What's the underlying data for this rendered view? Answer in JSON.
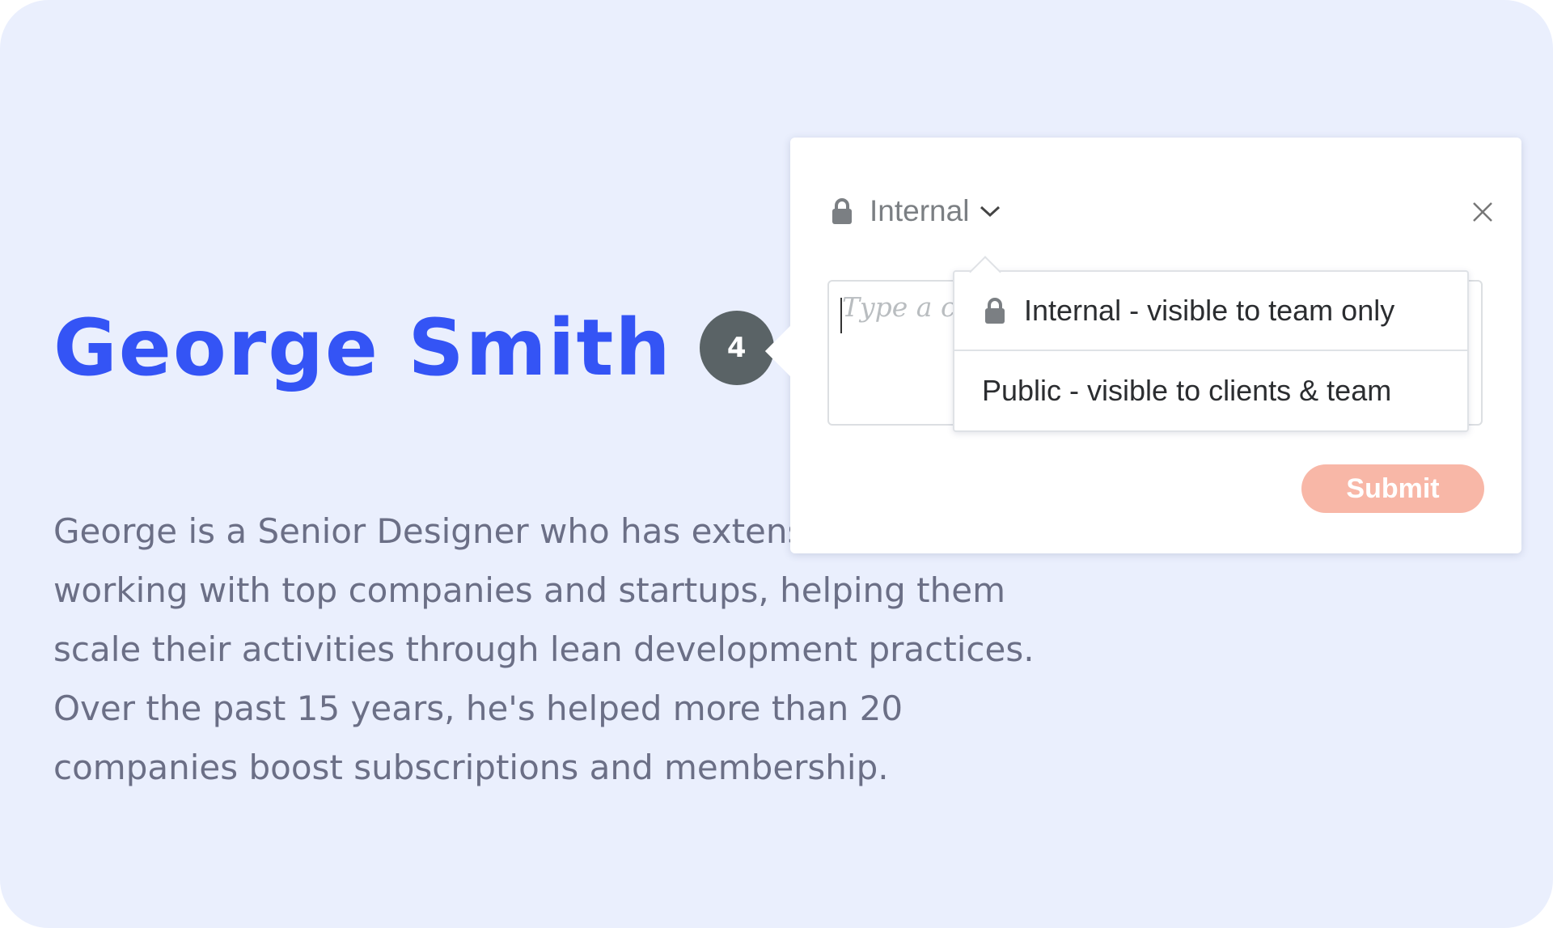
{
  "profile": {
    "name": "George Smith",
    "badge_count": "4",
    "bio": "George is a Senior Designer who has extensive experience working with top companies and startups, helping them scale their activities through lean development practices. Over the past 15 years, he's helped more than 20 companies boost subscriptions and membership."
  },
  "comment_popover": {
    "visibility_label": "Internal",
    "input_placeholder": "Type a comment...",
    "submit_label": "Submit",
    "visibility_options": [
      {
        "label": "Internal - visible to team only",
        "icon": "lock-icon"
      },
      {
        "label": "Public - visible to clients & team"
      }
    ],
    "icons": {
      "visibility": "lock-icon",
      "dropdown": "chevron-down-icon",
      "close": "close-icon"
    }
  },
  "colors": {
    "background": "#eaeffd",
    "name": "#3454f5",
    "badge": "#5a6366",
    "bio_text": "#6b6f86",
    "submit": "#f8b7a7"
  }
}
